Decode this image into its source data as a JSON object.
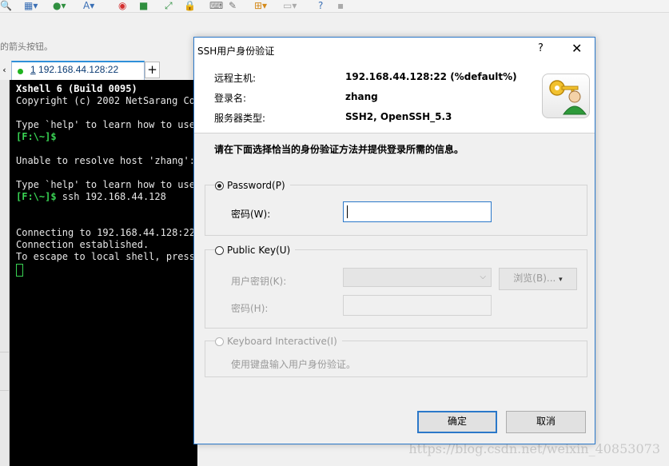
{
  "background_app": {
    "hint_text": "的箭头按钮。",
    "tab": {
      "number": "1",
      "host": "192.168.44.128:22",
      "add_label": "+"
    },
    "terminal": {
      "lines": [
        "Xshell 6 (Build 0095)",
        "Copyright (c) 2002 NetSarang Com",
        "",
        "Type `help' to learn how to use",
        "[F:\\~]$",
        "",
        "Unable to resolve host 'zhang':",
        "",
        "Type `help' to learn how to use",
        "[F:\\~]$ ssh 192.168.44.128",
        "",
        "",
        "Connecting to 192.168.44.128:22.",
        "Connection established.",
        "To escape to local shell, press"
      ]
    },
    "watermark": "https://blog.csdn.net/weixin_40853073"
  },
  "dialog": {
    "title": "SSH用户身份验证",
    "help_label": "?",
    "close_label": "✕",
    "info": {
      "host_label": "远程主机:",
      "host_value": "192.168.44.128:22 (%default%)",
      "login_label": "登录名:",
      "login_value": "zhang",
      "server_type_label": "服务器类型:",
      "server_type_value": "SSH2, OpenSSH_5.3"
    },
    "instruction": "请在下面选择恰当的身份验证方法并提供登录所需的信息。",
    "password_method": {
      "label": "Password(P)",
      "selected": true,
      "field_label": "密码(W):",
      "field_value": ""
    },
    "public_key_method": {
      "label": "Public Key(U)",
      "selected": false,
      "user_key_label": "用户密钥(K):",
      "user_key_value": "",
      "browse_label": "浏览(B)...",
      "passphrase_label": "密码(H):",
      "passphrase_value": ""
    },
    "keyboard_method": {
      "label": "Keyboard Interactive(I)",
      "selected": false,
      "description": "使用键盘输入用户身份验证。"
    },
    "ok_label": "确定",
    "cancel_label": "取消"
  },
  "colors": {
    "accent": "#2b78c9",
    "terminal_bg": "#000000",
    "prompt_green": "#39d353"
  }
}
